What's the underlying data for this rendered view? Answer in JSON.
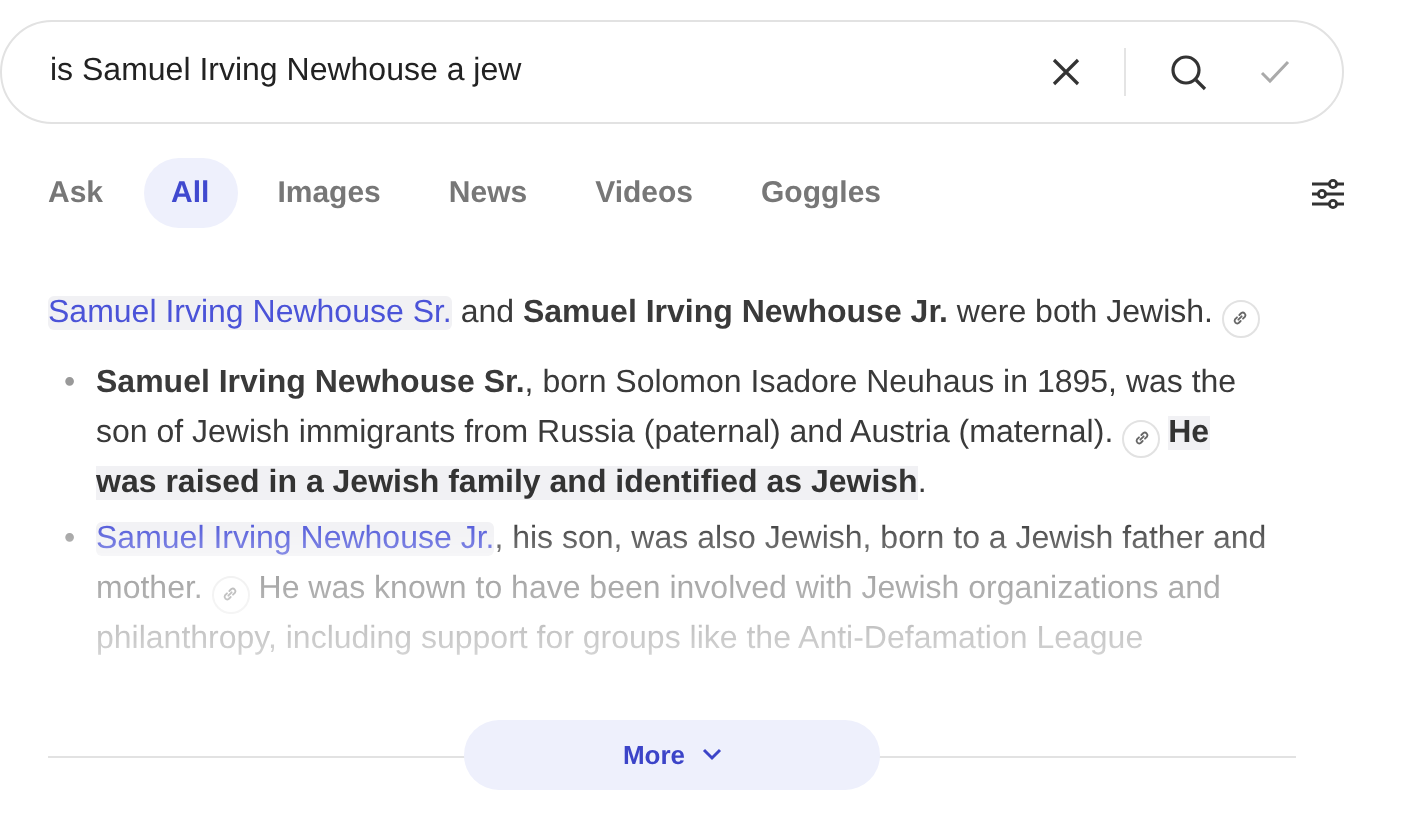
{
  "search": {
    "value": "is Samuel Irving Newhouse a jew"
  },
  "tabs": [
    {
      "label": "Ask",
      "selected": false
    },
    {
      "label": "All",
      "selected": true
    },
    {
      "label": "Images",
      "selected": false
    },
    {
      "label": "News",
      "selected": false
    },
    {
      "label": "Videos",
      "selected": false
    },
    {
      "label": "Goggles",
      "selected": false
    }
  ],
  "answer": {
    "summary": [
      {
        "kind": "link",
        "text": "Samuel Irving Newhouse Sr."
      },
      {
        "kind": "text",
        "text": " and **Samuel Irving Newhouse Jr.** were both Jewish. "
      },
      {
        "kind": "cite"
      }
    ],
    "bullets": [
      {
        "marker": "•",
        "segments": [
          {
            "kind": "text",
            "text": "**Samuel Irving Newhouse Sr.**, born Solomon Isadore Neuhaus in 1895, was the son of Jewish immigrants from Russia (paternal) and Austria (maternal). "
          },
          {
            "kind": "cite"
          },
          {
            "kind": "highlight",
            "text": "He was raised in a Jewish family and identified as Jewish"
          },
          {
            "kind": "text",
            "text": "."
          }
        ]
      },
      {
        "marker": "•",
        "segments": [
          {
            "kind": "link",
            "text": "Samuel Irving Newhouse Jr."
          },
          {
            "kind": "text",
            "text": ", his son, was also Jewish, born to a Jewish father and mother. "
          },
          {
            "kind": "cite"
          },
          {
            "kind": "text",
            "text": " He was known to have been involved with Jewish organizations and philanthropy, including support for groups like the Anti-Defamation League"
          }
        ]
      }
    ]
  },
  "more_button": {
    "label": "More"
  }
}
